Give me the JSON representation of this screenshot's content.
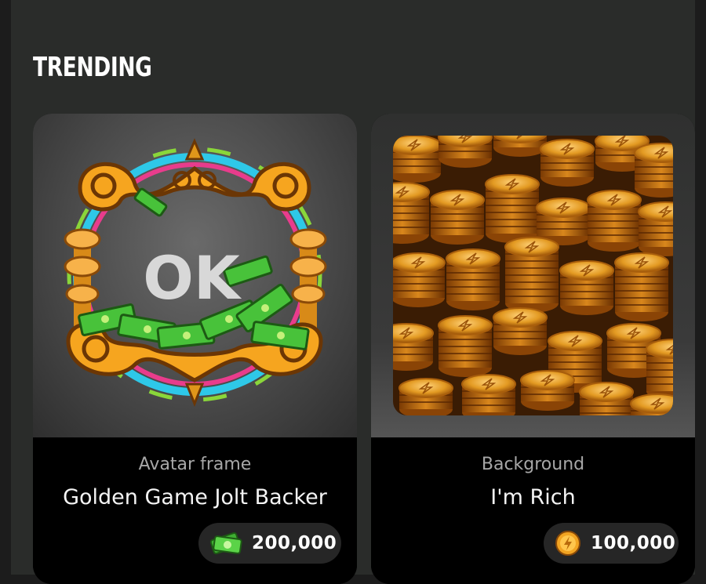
{
  "section": {
    "title": "TRENDING"
  },
  "items": [
    {
      "type": "Avatar frame",
      "name": "Golden Game Jolt Backer",
      "price": "200,000",
      "currency_icon": "money-icon",
      "artwork_text": "OK"
    },
    {
      "type": "Background",
      "name": "I'm Rich",
      "price": "100,000",
      "currency_icon": "coin-icon"
    }
  ],
  "colors": {
    "page_bg": "#2a2c2a",
    "card_info_bg": "#000000",
    "price_pill_bg": "#262626",
    "gold": "#f2a422",
    "cash_green": "#4ec43a"
  }
}
